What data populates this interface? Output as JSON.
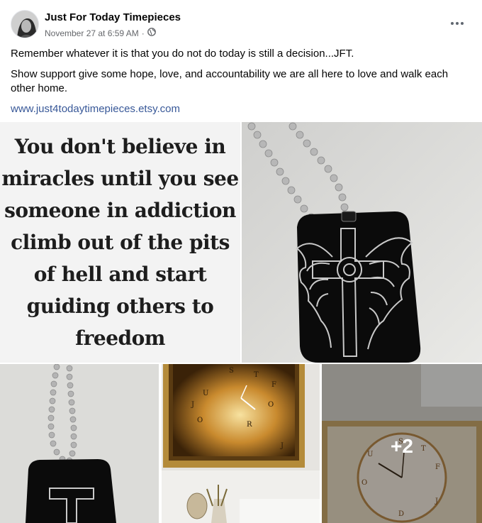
{
  "post": {
    "author": "Just For Today Timepieces",
    "timestamp": "November 27 at 6:59 AM",
    "separator": "·",
    "privacy_icon": "globe-icon",
    "more_icon": "more-options-icon",
    "lines": [
      "Remember whatever it is that you do not do today is still a decision...JFT.",
      "Show support give some hope, love, and accountability we are all here to love and walk each other home."
    ],
    "link": "www.just4todaytimepieces.etsy.com"
  },
  "photos": {
    "quote_image_text": "You don't believe in\nmiracles until you see\nsomeone in addiction\nclimb out of the pits\nof hell and start\nguiding others to\nfreedom",
    "more_count": "+2"
  },
  "colors": {
    "link": "#385898",
    "meta_text": "#65676b",
    "tag_black": "#0b0b0b",
    "engraving": "#c9c9c9"
  }
}
